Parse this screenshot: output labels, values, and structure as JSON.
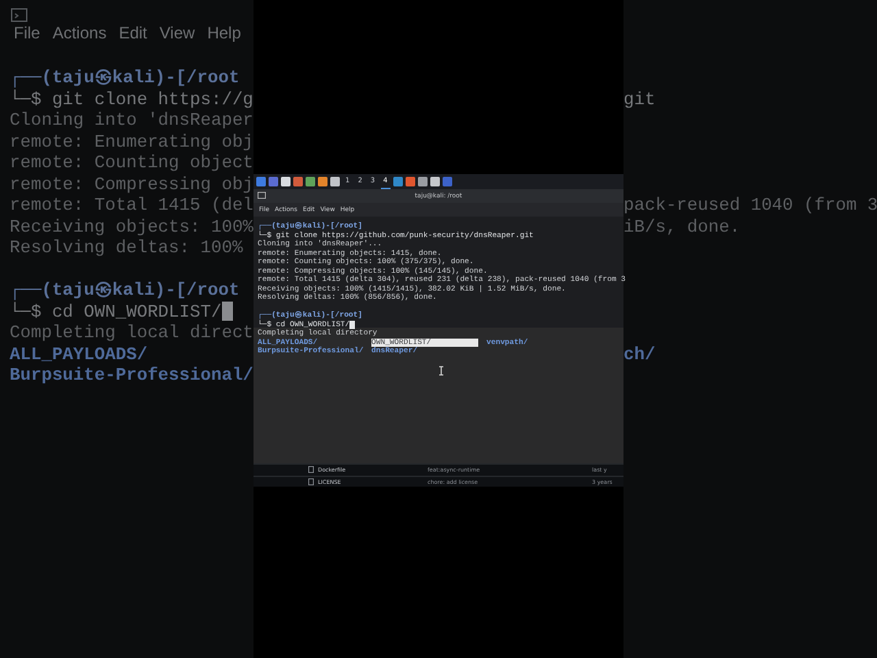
{
  "backdrop": {
    "menu": [
      "File",
      "Actions",
      "Edit",
      "View",
      "Help"
    ],
    "rows": [
      {
        "kind": "prompt",
        "left": "┌──(taju㉿kali)-[/root"
      },
      {
        "kind": "command",
        "left": "└─$ git clone https://g",
        "right": "git"
      },
      {
        "kind": "output",
        "left": "Cloning into 'dnsReaper"
      },
      {
        "kind": "output",
        "left": "remote: Enumerating obj"
      },
      {
        "kind": "output",
        "left": "remote: Counting object"
      },
      {
        "kind": "output",
        "left": "remote: Compressing obj"
      },
      {
        "kind": "output",
        "left": "remote: Total 1415 (del",
        "right": "pack-reused 1040 (from 3"
      },
      {
        "kind": "output",
        "left": "Receiving objects: 100%",
        "right": "iB/s, done."
      },
      {
        "kind": "output",
        "left": "Resolving deltas: 100%"
      },
      {
        "kind": "prompt",
        "left": "┌──(taju㉿kali)-[/root"
      },
      {
        "kind": "command",
        "left": "└─$ cd OWN_WORDLIST/",
        "cursor": true
      },
      {
        "kind": "output",
        "left": "Completing local direct"
      },
      {
        "kind": "dir",
        "left": "ALL_PAYLOADS/",
        "right": "ch/"
      },
      {
        "kind": "dir",
        "left": "Burpsuite-Professional/"
      }
    ]
  },
  "window": {
    "workspaces": [
      {
        "label": "1",
        "selected": false
      },
      {
        "label": "2",
        "selected": false
      },
      {
        "label": "3",
        "selected": false
      },
      {
        "label": "4",
        "selected": true
      }
    ],
    "title": "taju@kali: /root",
    "menu": [
      "File",
      "Actions",
      "Edit",
      "View",
      "Help"
    ],
    "rows": [
      {
        "kind": "prompt",
        "text": "┌──(taju㉿kali)-[/root]"
      },
      {
        "kind": "command",
        "text": "└─$ git clone https://github.com/punk-security/dnsReaper.git"
      },
      {
        "kind": "output",
        "text": "Cloning into 'dnsReaper'..."
      },
      {
        "kind": "output",
        "text": "remote: Enumerating objects: 1415, done."
      },
      {
        "kind": "output",
        "text": "remote: Counting objects: 100% (375/375), done."
      },
      {
        "kind": "output",
        "text": "remote: Compressing objects: 100% (145/145), done."
      },
      {
        "kind": "output",
        "text": "remote: Total 1415 (delta 304), reused 231 (delta 238), pack-reused 1040 (from 3"
      },
      {
        "kind": "output",
        "text": "Receiving objects: 100% (1415/1415), 382.02 KiB | 1.52 MiB/s, done."
      },
      {
        "kind": "output",
        "text": "Resolving deltas: 100% (856/856), done."
      },
      {
        "kind": "prompt",
        "text": "┌──(taju㉿kali)-[/root]"
      },
      {
        "kind": "command",
        "text": "└─$ cd OWN_WORDLIST/",
        "cursor": true
      },
      {
        "kind": "output",
        "text": "Completing local directory"
      }
    ],
    "completions": [
      {
        "text": "ALL_PAYLOADS/",
        "selected": false
      },
      {
        "text": "OWN_WORDLIST/",
        "selected": true
      },
      {
        "text": "venvpath/",
        "selected": false
      },
      {
        "text": "Burpsuite-Professional/",
        "selected": false
      },
      {
        "text": "dnsReaper/",
        "selected": false
      }
    ],
    "files": [
      {
        "name": "Dockerfile",
        "message": "feat:async-runtime",
        "time": "last y"
      },
      {
        "name": "LICENSE",
        "message": "chore: add license",
        "time": "3 years"
      }
    ]
  }
}
